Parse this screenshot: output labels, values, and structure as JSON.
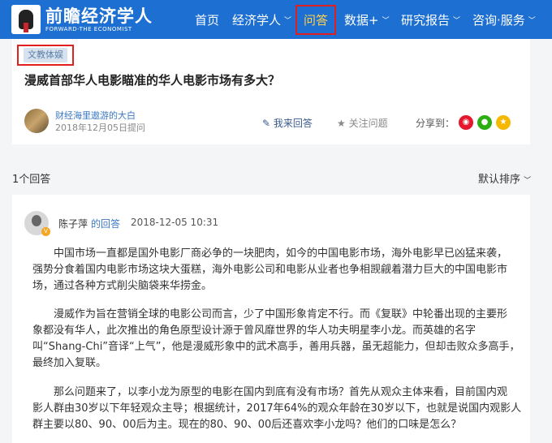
{
  "brand": {
    "title": "前瞻经济学人",
    "subtitle": "FORWARD-THE ECONOMIST"
  },
  "nav": [
    {
      "label": "首页",
      "chevron": ""
    },
    {
      "label": "经济学人",
      "chevron": "﹀"
    },
    {
      "label": "问答",
      "chevron": ""
    },
    {
      "label": "数据+",
      "chevron": "﹀"
    },
    {
      "label": "研究报告",
      "chevron": "﹀"
    },
    {
      "label": "咨询·服务",
      "chevron": "﹀"
    }
  ],
  "question": {
    "tag": "文教体娱",
    "title": "漫威首部华人电影瞄准的华人电影市场有多大？",
    "asker": "财经海里遨游的大白",
    "asked_time": "2018年12月05日提问",
    "answer_label": "我来回答",
    "follow_label": "关注问题",
    "share_label": "分享到："
  },
  "answers_header": {
    "count": "1个回答",
    "sort": "默认排序"
  },
  "answer": {
    "author": "陈子萍",
    "author_suffix": "的回答",
    "time": "2018-12-05 10:31",
    "paragraphs": [
      [
        "中国市场一直都是国外电影厂商必争的一块肥肉，如今的中国电影市场，海外电影早已凶猛来袭，",
        "强势分食着国内电影市场这块大蛋糕，海外电影公司和电影从业者也争相觊觎着潜力巨大的中国电影市",
        "场，通过各种方式削尖脑袋来华捞金。"
      ],
      [
        "漫威作为旨在营销全球的电影公司而言，少了中国形象肯定不行。而《复联》中轮番出现的主要形",
        "象都没有华人，此次推出的角色原型设计源于曾风靡世界的华人功夫明星李小龙。而英雄的名字",
        "叫“Shang-Chi”音译“上气”，他是漫威形象中的武术高手，善用兵器，虽无超能力，但却击败众多高手，",
        "最终加入复联。"
      ],
      [
        "那么问题来了，以李小龙为原型的电影在国内到底有没有市场？首先从观众主体来看，目前国内观",
        "影人群由30岁以下年轻观众主导；根据统计，2017年64%的观众年龄在30岁以下，也就是说国内观影人",
        "群主要以80、90、00后为主。现在的80、90、00后还喜欢李小龙吗？他们的口味是怎么？"
      ]
    ]
  },
  "icons": {
    "answer": "edit-icon",
    "follow": "star-icon",
    "share": [
      "weibo-icon",
      "wechat-icon",
      "qzone-icon"
    ]
  },
  "colors": {
    "header": "#1d6fd1",
    "highlight": "#e02020",
    "link": "#3a78c3"
  }
}
